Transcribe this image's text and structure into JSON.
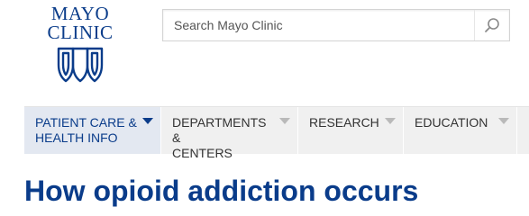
{
  "header": {
    "logo_line1": "MAYO",
    "logo_line2": "CLINIC",
    "brand_color": "#0a3c8a"
  },
  "search": {
    "placeholder": "Search Mayo Clinic",
    "icon": "search-icon"
  },
  "nav": {
    "items": [
      {
        "label": "PATIENT CARE &\nHEALTH INFO",
        "active": true
      },
      {
        "label": "DEPARTMENTS &\nCENTERS",
        "active": false
      },
      {
        "label": "RESEARCH",
        "active": false
      },
      {
        "label": "EDUCATION",
        "active": false
      }
    ]
  },
  "page": {
    "title": "How opioid addiction occurs"
  }
}
